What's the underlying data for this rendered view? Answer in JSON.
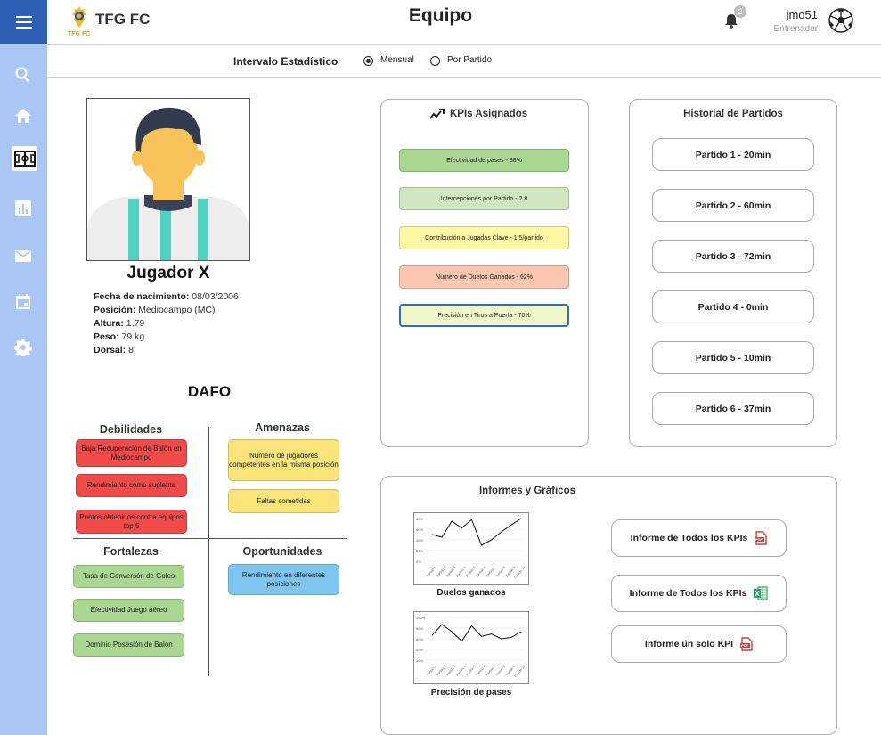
{
  "header": {
    "app_name": "TFG FC",
    "app_subtitle": "TFG FC",
    "title": "Equipo",
    "notifications_count": "2",
    "user_name": "jmo51",
    "user_role": "Entrenador"
  },
  "sidebar": {
    "items": [
      {
        "name": "search",
        "icon": "search-icon"
      },
      {
        "name": "home",
        "icon": "home-icon"
      },
      {
        "name": "team",
        "icon": "soccer-field-icon",
        "active": true
      },
      {
        "name": "stats",
        "icon": "bar-chart-icon"
      },
      {
        "name": "messages",
        "icon": "mail-icon"
      },
      {
        "name": "calendar",
        "icon": "calendar-icon"
      },
      {
        "name": "settings",
        "icon": "gear-icon"
      }
    ]
  },
  "interval": {
    "label": "Intervalo Estadístico",
    "options": [
      "Mensual",
      "Por Partido"
    ],
    "selected": "Mensual"
  },
  "player": {
    "name": "Jugador X",
    "fields": [
      {
        "label": "Fecha de nacimiento:",
        "value": "08/03/2006"
      },
      {
        "label": "Posición:",
        "value": "Mediocampo (MC)"
      },
      {
        "label": "Altura:",
        "value": "1.79"
      },
      {
        "label": "Peso:",
        "value": "79 kg"
      },
      {
        "label": "Dorsal:",
        "value": "8"
      }
    ]
  },
  "dafo": {
    "title": "DAFO",
    "debilidades": {
      "title": "Debilidades",
      "items": [
        "Baja Recuperación de Balón en Mediocampo",
        "Rendimiento como suplente",
        "Puntos obtenidos contra equipos top 5"
      ]
    },
    "amenazas": {
      "title": "Amenazas",
      "items": [
        "Número de jugadores competentes en la misma posición",
        "Faltas cometidas"
      ]
    },
    "fortalezas": {
      "title": "Fortalezas",
      "items": [
        "Tasa de Conversón de Goles",
        "Efectividad Juego aéreo",
        "Dominio Posesión de Balón"
      ]
    },
    "oportunidades": {
      "title": "Oportunidades",
      "items": [
        "Rendimiento en diferentes posiciones"
      ]
    }
  },
  "kpis": {
    "title": "KPIs Asignados",
    "items": [
      {
        "label": "Efectividad de pases - 88%",
        "color": "#a9d690"
      },
      {
        "label": "Intercepciones por Partido - 2.8",
        "color": "#cfe6c0"
      },
      {
        "label": "Contribución a Jugadas Clave - 1.5/partido",
        "color": "#fdf6a3"
      },
      {
        "label": "Número de Duelos Ganados - 62%",
        "color": "#fbc6b0"
      },
      {
        "label": "Precisión en Tiros a Puerta - 70%",
        "color": "#eef7c8"
      }
    ]
  },
  "history": {
    "title": "Historial de Partidos",
    "matches": [
      "Partido 1 - 20min",
      "Partido 2 - 60min",
      "Partido 3 - 72min",
      "Partido 4 - 0min",
      "Partido 5 - 10min",
      "Partido 6 - 37min"
    ]
  },
  "reports": {
    "title": "Informes y Gráficos",
    "buttons": [
      {
        "label": "Informe de Todos los KPIs",
        "icon": "pdf-icon"
      },
      {
        "label": "Informe de Todos los KPIs",
        "icon": "excel-icon"
      },
      {
        "label": "Informe ún solo KPI",
        "icon": "pdf-icon"
      }
    ],
    "charts": [
      {
        "label": "Duelos ganados"
      },
      {
        "label": "Precisión de pases"
      }
    ]
  },
  "chart_data": [
    {
      "type": "line",
      "title": "Duelos ganados",
      "categories": [
        "Partido 1",
        "Partido 2",
        "Partido 3",
        "Partido 4",
        "Partido 5",
        "Partido 6",
        "Partido 7",
        "Partido 8",
        "Partido 9",
        "Partido 10"
      ],
      "y_ticks": [
        "0%",
        "20%",
        "40%",
        "60%",
        "80%"
      ],
      "values": [
        50,
        45,
        75,
        62,
        78,
        30,
        40,
        55,
        68,
        80
      ],
      "ylim": [
        0,
        80
      ]
    },
    {
      "type": "line",
      "title": "Precisión de pases",
      "categories": [
        "Partido 1",
        "Partido 2",
        "Partido 3",
        "Partido 4",
        "Partido 5",
        "Partido 6",
        "Partido 7",
        "Partido 8",
        "Partido 9",
        "Partido 10"
      ],
      "y_ticks": [
        "10%",
        "40%",
        "60%",
        "90%",
        "100%"
      ],
      "values": [
        62,
        85,
        70,
        50,
        82,
        60,
        65,
        55,
        58,
        70
      ],
      "ylim": [
        10,
        100
      ]
    }
  ]
}
